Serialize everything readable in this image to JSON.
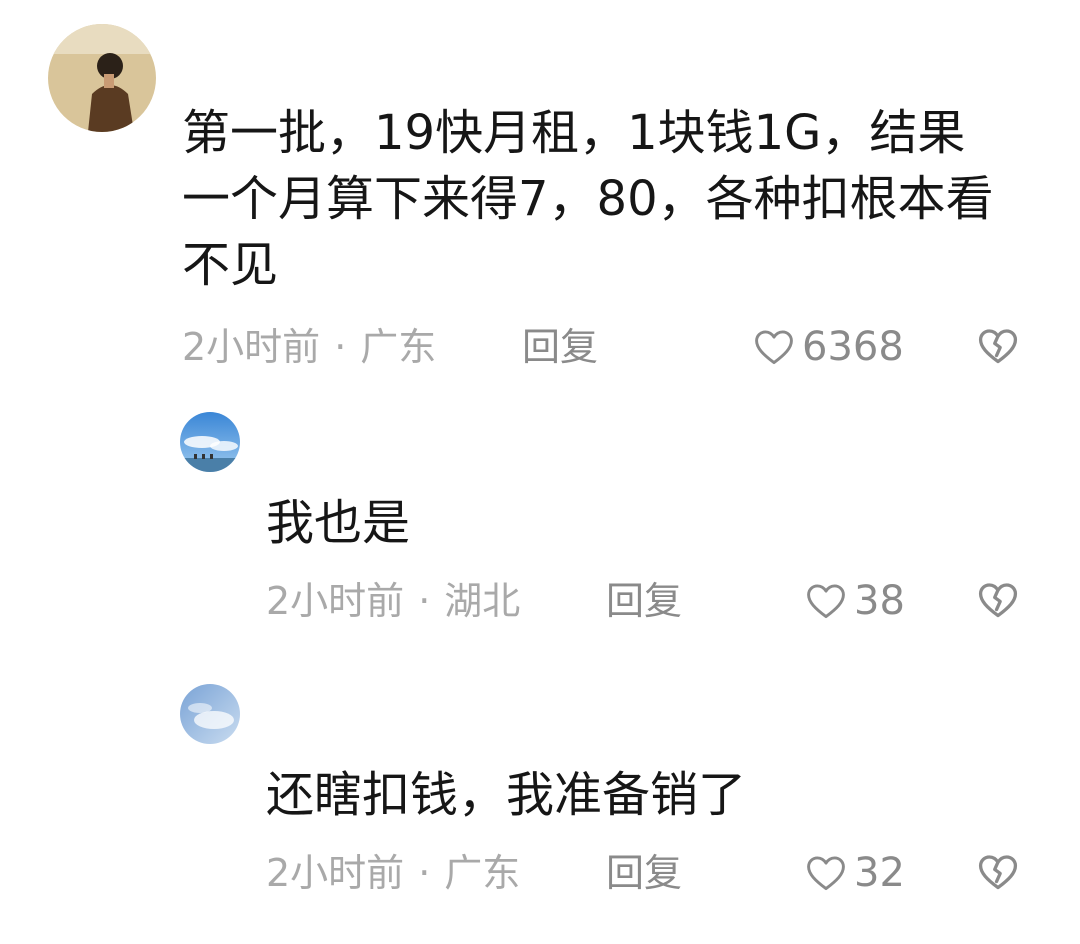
{
  "comments": [
    {
      "text": "第一批，19快月租，1块钱1G，结果\n一个月算下来得7，80，各种扣根本看\n不见",
      "time": "2小时前",
      "separator": "·",
      "location": "广东",
      "reply_label": "回复",
      "likes": "6368",
      "avatar_icon": "user-avatar-man"
    },
    {
      "text": "我也是",
      "time": "2小时前",
      "separator": "·",
      "location": "湖北",
      "reply_label": "回复",
      "likes": "38",
      "avatar_icon": "user-avatar-sky"
    },
    {
      "text": "还瞎扣钱，我准备销了",
      "time": "2小时前",
      "separator": "·",
      "location": "广东",
      "reply_label": "回复",
      "likes": "32",
      "avatar_icon": "user-avatar-clouds"
    }
  ],
  "icons": {
    "like": "heart-outline-icon",
    "dislike": "broken-heart-icon"
  },
  "colors": {
    "text": "#161616",
    "meta": "#a9a9a9",
    "action": "#8a8a8a"
  }
}
